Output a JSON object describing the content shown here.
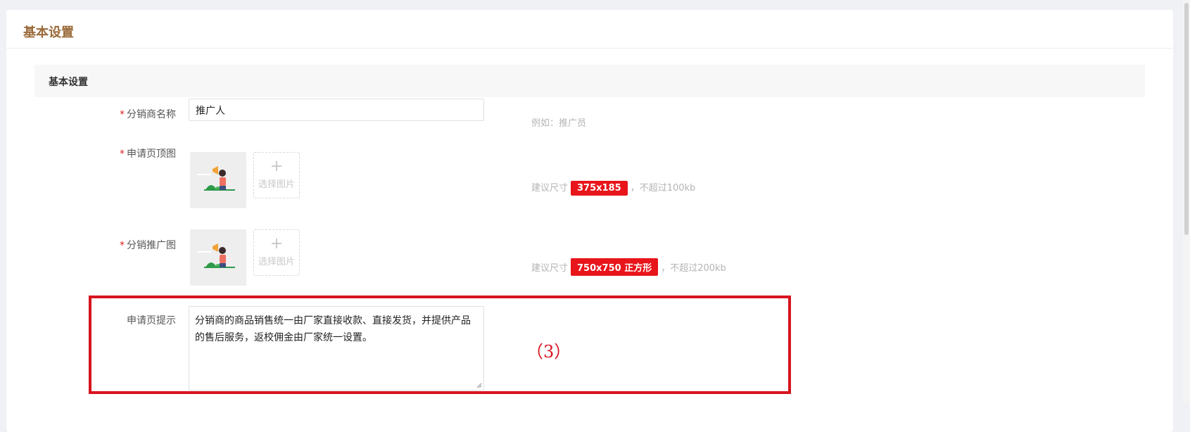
{
  "page": {
    "title": "基本设置"
  },
  "section": {
    "title": "基本设置"
  },
  "fields": {
    "name": {
      "label": "分销商名称",
      "value": "推广人",
      "hint": "例如：推广员"
    },
    "apply_header": {
      "label": "申请页顶图",
      "hint_prefix": "建议尺寸",
      "badge": "375x185",
      "hint_suffix": "，不超过100kb",
      "upload_text": "选择图片",
      "plus": "+"
    },
    "promo_image": {
      "label": "分销推广图",
      "hint_prefix": "建议尺寸",
      "badge": "750x750 正方形",
      "hint_suffix": "，不超过200kb",
      "upload_text": "选择图片",
      "plus": "+"
    },
    "apply_tip": {
      "label": "申请页提示",
      "value": "分销商的商品销售统一由厂家直接收款、直接发货，并提供产品的售后服务，返校佣金由厂家统一设置。"
    }
  },
  "required_mark": "*",
  "annotation": "（3）",
  "colors": {
    "title": "#9a6a3a",
    "badge": "#e8151b",
    "highlight": "#d7141f"
  }
}
